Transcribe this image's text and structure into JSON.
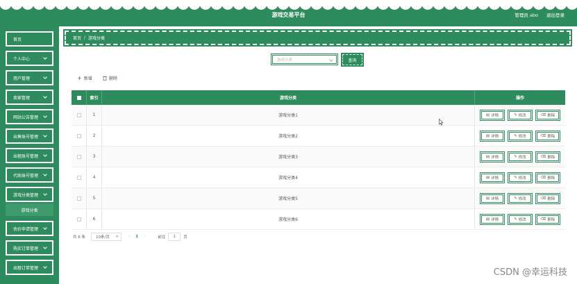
{
  "header": {
    "title": "游戏交易平台",
    "user": "管理员 abo",
    "logout": "退出登录"
  },
  "sidebar": {
    "items": [
      {
        "label": "首页",
        "chevron": false
      },
      {
        "label": "个人中心",
        "chevron": true
      },
      {
        "label": "用户管理",
        "chevron": true
      },
      {
        "label": "卖家管理",
        "chevron": true
      },
      {
        "label": "网站公告管理",
        "chevron": true
      },
      {
        "label": "出售账号管理",
        "chevron": true
      },
      {
        "label": "出租账号管理",
        "chevron": true
      },
      {
        "label": "代练账号管理",
        "chevron": true
      },
      {
        "label": "游戏分类管理",
        "chevron": true
      },
      {
        "label": "估价申请管理",
        "chevron": true
      },
      {
        "label": "购买订单管理",
        "chevron": true
      },
      {
        "label": "出租订单管理",
        "chevron": true
      }
    ],
    "sub_item": "游戏分类"
  },
  "breadcrumb": {
    "home": "首页",
    "sep": "/",
    "current": "游戏分类"
  },
  "search": {
    "placeholder": "游戏分类",
    "button": "查询"
  },
  "actions": {
    "add": "新增",
    "delete": "删除"
  },
  "table": {
    "headers": {
      "index": "索引",
      "name": "游戏分类",
      "ops": "操作"
    },
    "rows": [
      {
        "index": "1",
        "name": "游戏分类1"
      },
      {
        "index": "2",
        "name": "游戏分类2"
      },
      {
        "index": "3",
        "name": "游戏分类3"
      },
      {
        "index": "4",
        "name": "游戏分类4"
      },
      {
        "index": "5",
        "name": "游戏分类5"
      },
      {
        "index": "6",
        "name": "游戏分类6"
      }
    ],
    "ops": {
      "detail": "详情",
      "edit": "修改",
      "delete": "删除"
    }
  },
  "pagination": {
    "total": "共 6 条",
    "page_size": "10条/页",
    "current": "1",
    "goto_prefix": "前往",
    "goto_value": "1",
    "goto_suffix": "页"
  },
  "watermark": "CSDN @幸运科技",
  "colors": {
    "accent": "#2e8b5e"
  }
}
